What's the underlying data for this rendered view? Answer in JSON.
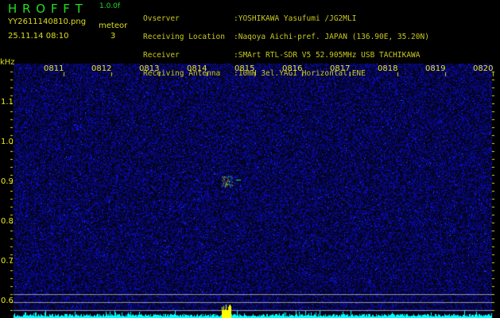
{
  "app": {
    "title": "H R O F F T",
    "version": "1.0.0f"
  },
  "file": {
    "name": "YY2611140810.png",
    "datetime": "25.11.14 08:10"
  },
  "meteor": {
    "label": "meteor",
    "count": "3"
  },
  "info": [
    {
      "label": "Ovserver",
      "value": ":YOSHIKAWA Yasufumi /JG2MLI"
    },
    {
      "label": "Receiving Location",
      "value": ":Naqoya Aichi-pref. JAPAN (136.90E, 35.20N)"
    },
    {
      "label": "Receiver",
      "value": ":SMArt RTL-SDR V5 52.905MHz USB TACHIKAWA"
    },
    {
      "label": "Receiving Antenna",
      "value": ":10mH 3el.YAGI Horizontal:ENE"
    }
  ],
  "axis": {
    "unit": "kHz",
    "x_labels": [
      "0811",
      "0812",
      "0813",
      "0814",
      "0815",
      "0816",
      "0817",
      "0818",
      "0819",
      "0820"
    ],
    "y_labels": [
      "1.1",
      "1.0",
      "0.9",
      "0.8",
      "0.7",
      "0.6"
    ]
  },
  "colors": {
    "bg": "#000000",
    "noise": "#1a1aa0",
    "text": "#dddd22",
    "title": "#22dd22",
    "spectrum": "#00ffff",
    "peak": "#ffff00"
  },
  "event": {
    "time_minute": "0815",
    "freq_khz": 0.9
  }
}
